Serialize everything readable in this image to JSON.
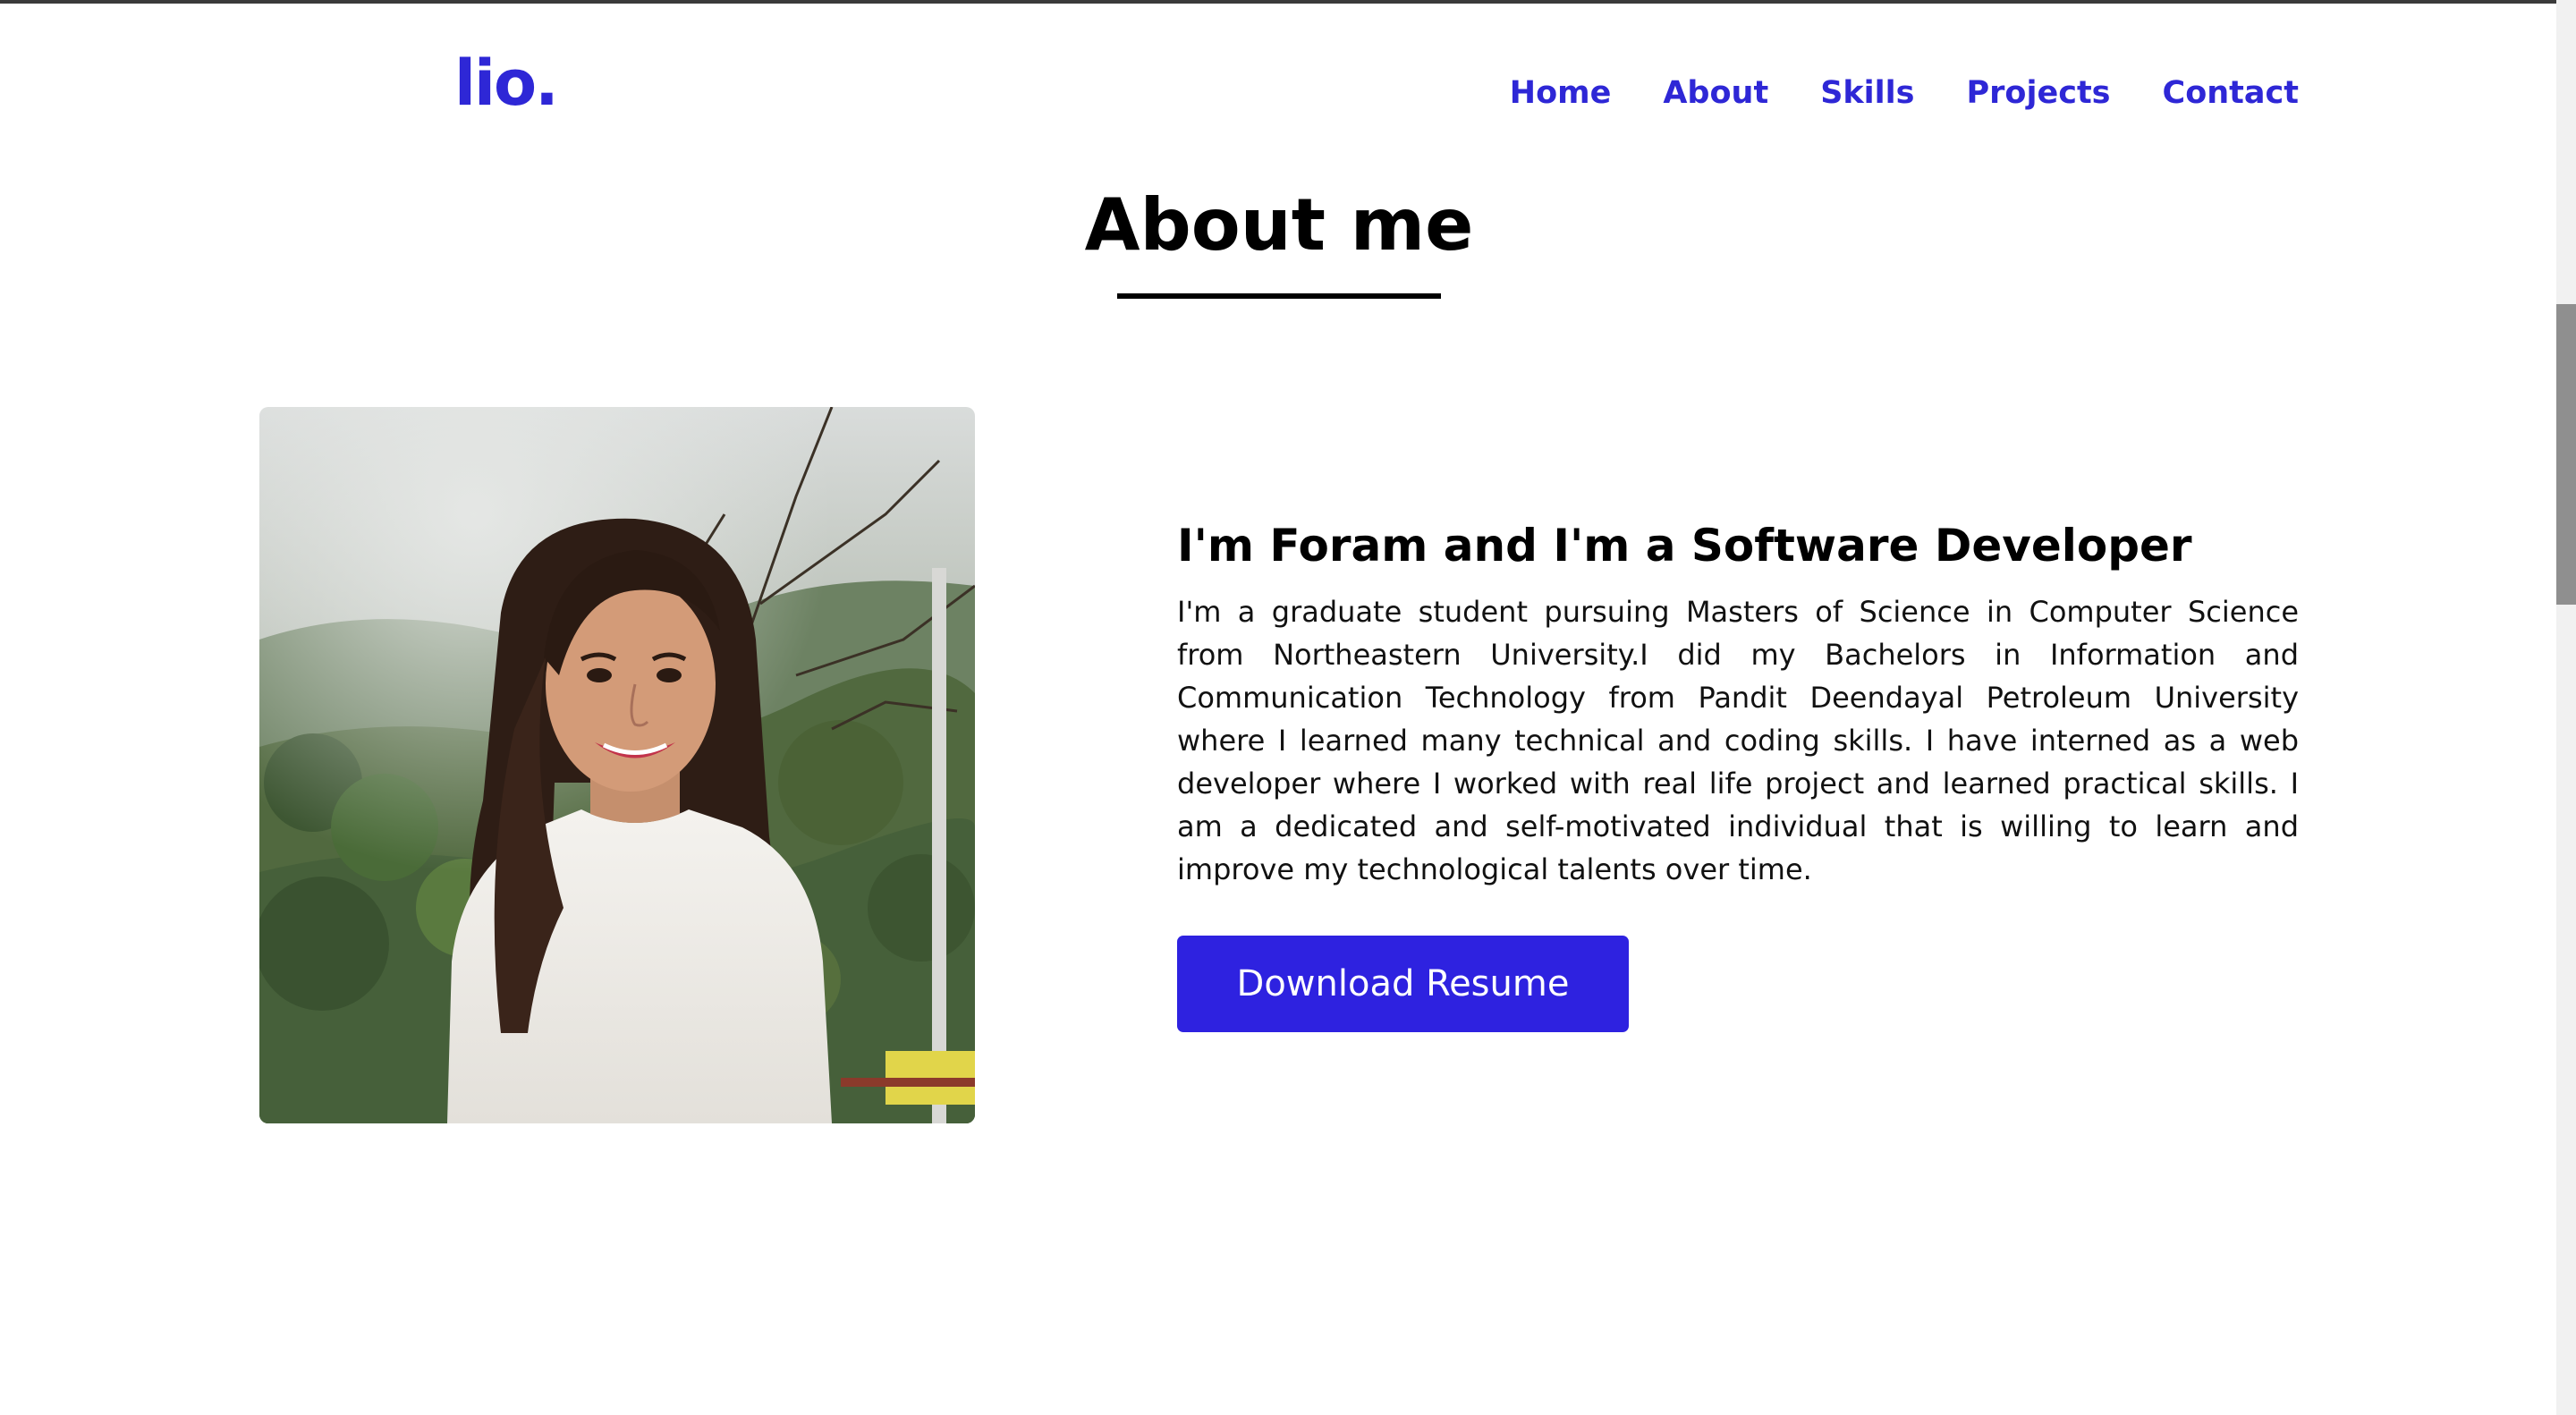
{
  "header": {
    "logo": "lio.",
    "nav": [
      "Home",
      "About",
      "Skills",
      "Projects",
      "Contact"
    ]
  },
  "about": {
    "title": "About me",
    "headline": "I'm Foram and I'm a Software Developer",
    "bio": "I'm a graduate student pursuing Masters of Science in Computer Science from Northeastern University.I did my Bachelors in Information and Communication Technology from Pandit Deendayal Petroleum University where I learned many technical and coding skills. I have interned as a web developer where I worked with real life project and learned practical skills. I am a dedicated and self-motivated individual that is willing to learn and improve my technological talents over time.",
    "button": "Download Resume"
  },
  "colors": {
    "accent": "#2e27d6",
    "button": "#2e22e0",
    "text": "#000000"
  },
  "icons": {
    "photo": "profile-photo"
  }
}
